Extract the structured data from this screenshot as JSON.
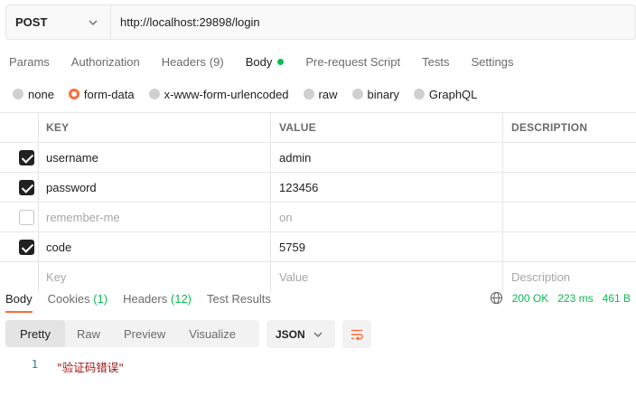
{
  "request": {
    "method": "POST",
    "url": "http://localhost:29898/login"
  },
  "request_tabs": [
    {
      "label": "Params"
    },
    {
      "label": "Authorization"
    },
    {
      "label": "Headers",
      "count": "(9)"
    },
    {
      "label": "Body",
      "active": true
    },
    {
      "label": "Pre-request Script"
    },
    {
      "label": "Tests"
    },
    {
      "label": "Settings"
    }
  ],
  "body_types": [
    {
      "label": "none",
      "selected": false
    },
    {
      "label": "form-data",
      "selected": true
    },
    {
      "label": "x-www-form-urlencoded",
      "selected": false
    },
    {
      "label": "raw",
      "selected": false
    },
    {
      "label": "binary",
      "selected": false
    },
    {
      "label": "GraphQL",
      "selected": false
    }
  ],
  "table": {
    "headers": {
      "key": "KEY",
      "value": "VALUE",
      "description": "DESCRIPTION"
    },
    "rows": [
      {
        "checked": true,
        "key": "username",
        "value": "admin",
        "description": ""
      },
      {
        "checked": true,
        "key": "password",
        "value": "123456",
        "description": ""
      },
      {
        "checked": false,
        "key": "remember-me",
        "value": "on",
        "description": ""
      },
      {
        "checked": true,
        "key": "code",
        "value": "5759",
        "description": ""
      }
    ],
    "placeholder": {
      "key": "Key",
      "value": "Value",
      "description": "Description"
    }
  },
  "response_tabs": [
    {
      "label": "Body",
      "active": true
    },
    {
      "label": "Cookies",
      "count": "(1)"
    },
    {
      "label": "Headers",
      "count": "(12)"
    },
    {
      "label": "Test Results"
    }
  ],
  "response_status": {
    "status": "200 OK",
    "time": "223 ms",
    "size": "461 B"
  },
  "view_modes": [
    {
      "label": "Pretty",
      "active": true
    },
    {
      "label": "Raw"
    },
    {
      "label": "Preview"
    },
    {
      "label": "Visualize"
    }
  ],
  "format": "JSON",
  "response_body": [
    {
      "line": "1",
      "text": "\"验证码错误\""
    }
  ],
  "colors": {
    "accent": "#ff6c37",
    "success": "#0cbb52"
  }
}
